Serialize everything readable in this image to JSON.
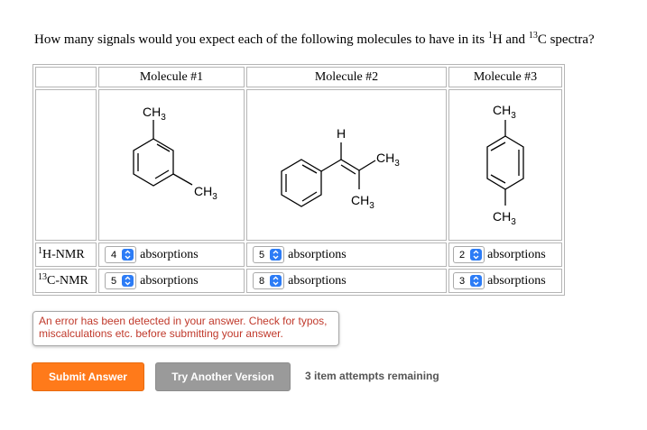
{
  "question": {
    "prefix": "How many signals would you expect each of the following molecules to have in its ",
    "h_sup": "1",
    "h_text": "H and ",
    "c_sup": "13",
    "c_text": "C spectra?"
  },
  "table": {
    "headers": [
      "Molecule #1",
      "Molecule #2",
      "Molecule #3"
    ],
    "molecule_labels": {
      "m1": {
        "ch3_top": "CH3",
        "ch3_bottom": "CH3"
      },
      "m2": {
        "h": "H",
        "ch3_right": "CH3",
        "ch3_bottom": "CH3"
      },
      "m3": {
        "ch3_top": "CH3",
        "ch3_bottom": "CH3"
      }
    },
    "rows": [
      {
        "label_sup": "1",
        "label_text": "H-NMR",
        "values": [
          "4",
          "5",
          "2"
        ],
        "unit": "absorptions"
      },
      {
        "label_sup": "13",
        "label_text": "C-NMR",
        "values": [
          "5",
          "8",
          "3"
        ],
        "unit": "absorptions"
      }
    ]
  },
  "error_message": "An error has been detected in your answer. Check for typos, miscalculations etc. before submitting your answer.",
  "buttons": {
    "submit": "Submit Answer",
    "try_another": "Try Another Version"
  },
  "attempts_text": "3 item attempts remaining",
  "colors": {
    "submit_bg": "#ff7a1a",
    "try_bg": "#9a9a9a",
    "error_text": "#c0392b",
    "select_arrow": "#2c7cf6"
  }
}
